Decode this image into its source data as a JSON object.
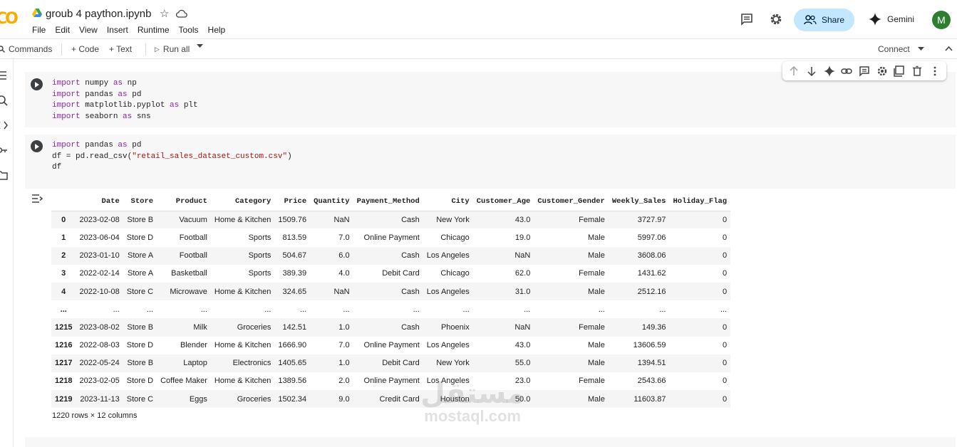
{
  "header": {
    "logo": "CO",
    "title": "groub 4 paython.ipynb",
    "menu": [
      "File",
      "Edit",
      "View",
      "Insert",
      "Runtime",
      "Tools",
      "Help"
    ],
    "share_label": "Share",
    "gemini_label": "Gemini",
    "avatar_initial": "M"
  },
  "toolbar": {
    "commands": "Commands",
    "code": "+ Code",
    "text": "+ Text",
    "run_all": "Run all",
    "connect": "Connect"
  },
  "cells": [
    {
      "lines": [
        [
          {
            "t": "import",
            "k": 1
          },
          {
            "t": " numpy "
          },
          {
            "t": "as",
            "k": 1
          },
          {
            "t": " np"
          }
        ],
        [
          {
            "t": "import",
            "k": 1
          },
          {
            "t": " pandas "
          },
          {
            "t": "as",
            "k": 1
          },
          {
            "t": " pd"
          }
        ],
        [
          {
            "t": "import",
            "k": 1
          },
          {
            "t": " matplotlib.pyplot "
          },
          {
            "t": "as",
            "k": 1
          },
          {
            "t": " plt"
          }
        ],
        [
          {
            "t": "import",
            "k": 1
          },
          {
            "t": " seaborn "
          },
          {
            "t": "as",
            "k": 1
          },
          {
            "t": " sns"
          }
        ]
      ]
    },
    {
      "lines": [
        [
          {
            "t": "import",
            "k": 1
          },
          {
            "t": " pandas "
          },
          {
            "t": "as",
            "k": 1
          },
          {
            "t": " pd"
          }
        ],
        [
          {
            "t": "df = pd.read_csv("
          },
          {
            "t": "\"retail_sales_dataset_custom.csv\"",
            "s": 1
          },
          {
            "t": ")"
          }
        ],
        [
          {
            "t": "df"
          }
        ]
      ]
    }
  ],
  "dataframe": {
    "columns": [
      "",
      "Date",
      "Store",
      "Product",
      "Category",
      "Price",
      "Quantity",
      "Payment_Method",
      "City",
      "Customer_Age",
      "Customer_Gender",
      "Weekly_Sales",
      "Holiday_Flag"
    ],
    "rows": [
      [
        "0",
        "2023-02-08",
        "Store B",
        "Vacuum",
        "Home & Kitchen",
        "1509.76",
        "NaN",
        "Cash",
        "New York",
        "43.0",
        "Female",
        "3727.97",
        "0"
      ],
      [
        "1",
        "2023-06-04",
        "Store D",
        "Football",
        "Sports",
        "813.59",
        "7.0",
        "Online Payment",
        "Chicago",
        "19.0",
        "Male",
        "5997.06",
        "0"
      ],
      [
        "2",
        "2023-01-10",
        "Store A",
        "Football",
        "Sports",
        "504.67",
        "6.0",
        "Cash",
        "Los Angeles",
        "NaN",
        "Male",
        "3608.06",
        "0"
      ],
      [
        "3",
        "2022-02-14",
        "Store A",
        "Basketball",
        "Sports",
        "389.39",
        "4.0",
        "Debit Card",
        "Chicago",
        "62.0",
        "Female",
        "1431.62",
        "0"
      ],
      [
        "4",
        "2022-10-08",
        "Store C",
        "Microwave",
        "Home & Kitchen",
        "324.65",
        "NaN",
        "Cash",
        "Los Angeles",
        "31.0",
        "Male",
        "2512.16",
        "0"
      ],
      [
        "...",
        "...",
        "...",
        "...",
        "...",
        "...",
        "...",
        "...",
        "...",
        "...",
        "...",
        "...",
        "..."
      ],
      [
        "1215",
        "2023-08-02",
        "Store B",
        "Milk",
        "Groceries",
        "142.51",
        "1.0",
        "Cash",
        "Phoenix",
        "NaN",
        "Female",
        "149.36",
        "0"
      ],
      [
        "1216",
        "2022-08-03",
        "Store D",
        "Blender",
        "Home & Kitchen",
        "1666.90",
        "7.0",
        "Online Payment",
        "Los Angeles",
        "43.0",
        "Male",
        "13606.59",
        "0"
      ],
      [
        "1217",
        "2022-05-24",
        "Store B",
        "Laptop",
        "Electronics",
        "1405.65",
        "1.0",
        "Debit Card",
        "New York",
        "55.0",
        "Male",
        "1394.51",
        "0"
      ],
      [
        "1218",
        "2023-02-05",
        "Store D",
        "Coffee Maker",
        "Home & Kitchen",
        "1389.56",
        "2.0",
        "Online Payment",
        "Los Angeles",
        "23.0",
        "Female",
        "2543.66",
        "0"
      ],
      [
        "1219",
        "2023-11-13",
        "Store C",
        "Eggs",
        "Groceries",
        "1502.34",
        "9.0",
        "Credit Card",
        "Houston",
        "50.0",
        "Male",
        "11603.87",
        "0"
      ]
    ],
    "shape": "1220 rows × 12 columns"
  },
  "watermark": {
    "arabic": "مستقل",
    "latin": "mostaql.com"
  },
  "colors": {
    "keyword": "#8e24aa",
    "string": "#a31515",
    "share_bg": "#c2e7ff",
    "logo": "#f9ab00",
    "avatar": "#2e7d32"
  }
}
